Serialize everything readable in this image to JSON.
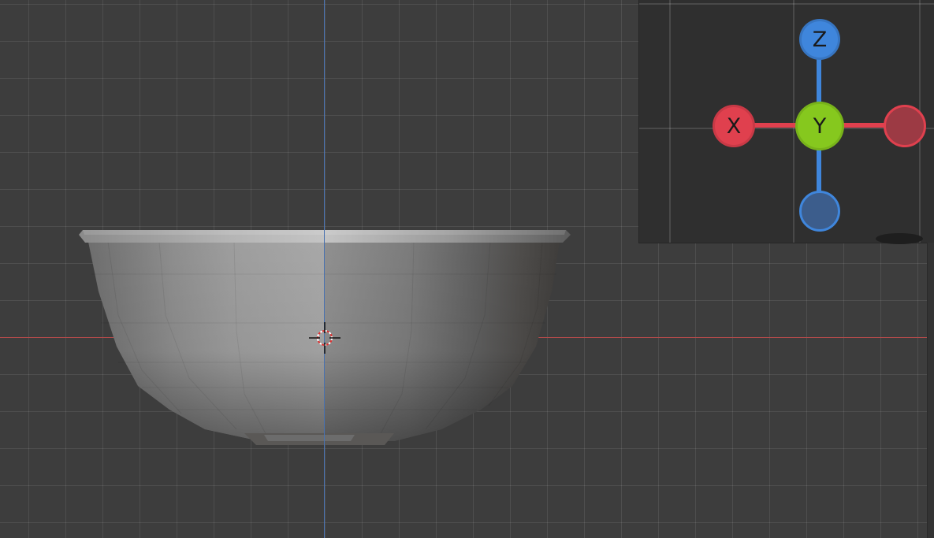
{
  "viewport": {
    "view": "front",
    "object": "bowl",
    "colors": {
      "background": "#3d3d3d",
      "x_axis": "#b34a4a",
      "z_axis": "#4a72b0",
      "mesh_light": "#a8a8a8",
      "mesh_dark": "#3e3c3a"
    }
  },
  "gizmo": {
    "z_label": "Z",
    "y_label": "Y",
    "x_label": "X",
    "colors": {
      "x": "#e0404e",
      "x_negative": "#9c3a44",
      "y": "#86c81e",
      "z": "#3f86dc",
      "z_negative": "#3c5d8c"
    }
  }
}
